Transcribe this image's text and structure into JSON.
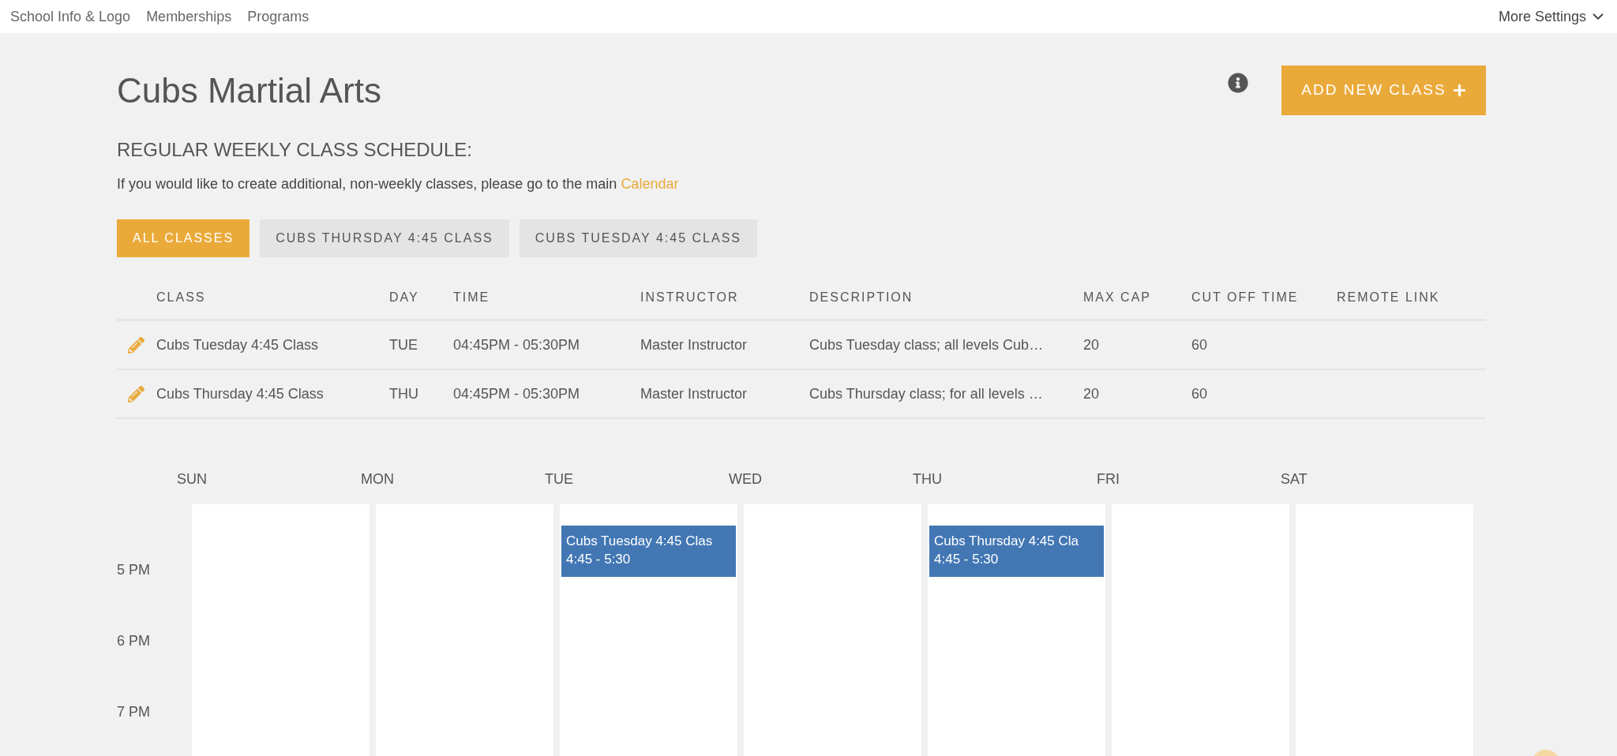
{
  "top_nav": {
    "items": [
      {
        "label": "School Info & Logo"
      },
      {
        "label": "Memberships"
      },
      {
        "label": "Programs"
      }
    ],
    "more": "More Settings"
  },
  "header": {
    "title": "Cubs Martial Arts",
    "add_button": "ADD NEW CLASS"
  },
  "schedule_heading": "REGULAR WEEKLY CLASS SCHEDULE:",
  "intro": {
    "text": "If you would like to create additional, non-weekly classes, please go to the main",
    "link": "Calendar"
  },
  "filters": [
    {
      "label": "ALL CLASSES",
      "selected": true
    },
    {
      "label": "CUBS THURSDAY 4:45 CLASS",
      "selected": false
    },
    {
      "label": "CUBS TUESDAY 4:45 CLASS",
      "selected": false
    }
  ],
  "table": {
    "columns": [
      "CLASS",
      "DAY",
      "TIME",
      "INSTRUCTOR",
      "DESCRIPTION",
      "MAX CAP",
      "CUT OFF TIME",
      "REMOTE LINK"
    ],
    "rows": [
      [
        "Cubs Tuesday 4:45 Class",
        "TUE",
        "04:45PM - 05:30PM",
        "Master Instructor",
        "Cubs Tuesday class; all levels Cub…",
        "20",
        "60"
      ],
      [
        "Cubs Thursday 4:45 Class",
        "THU",
        "04:45PM - 05:30PM",
        "Master Instructor",
        "Cubs Thursday class; for all levels …",
        "20",
        "60"
      ]
    ]
  },
  "calendar": {
    "hours": [
      "5 PM",
      "6 PM",
      "7 PM"
    ],
    "days": [
      {
        "label": "SUN"
      },
      {
        "label": "MON"
      },
      {
        "label": "TUE",
        "events": [
          {
            "title": "Cubs Tuesday 4:45 Clas",
            "time": "4:45 - 5:30"
          }
        ]
      },
      {
        "label": "WED"
      },
      {
        "label": "THU",
        "events": [
          {
            "title": "Cubs Thursday 4:45 Cla",
            "time": "4:45 - 5:30"
          }
        ]
      },
      {
        "label": "FRI"
      },
      {
        "label": "SAT"
      }
    ]
  }
}
